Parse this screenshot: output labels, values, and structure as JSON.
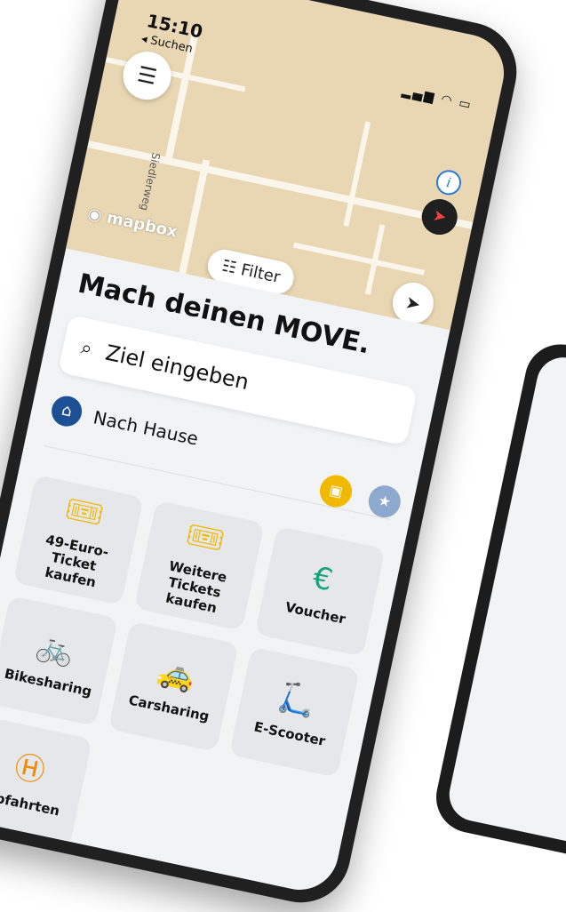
{
  "status": {
    "time": "15:10",
    "back_label": "◂ Suchen",
    "signal": "▂▄▆ ◠ ▭"
  },
  "map": {
    "attribution": "mapbox",
    "street_label": "Siedlerweg",
    "filter_label": "Filter"
  },
  "sheet": {
    "headline": "Mach deinen MOVE.",
    "search_placeholder": "Ziel eingeben",
    "home_label": "Nach Hause"
  },
  "tiles": [
    {
      "label": "49-Euro-Ticket kaufen",
      "icon": "ticket-icon",
      "color": "#f1b800"
    },
    {
      "label": "Weitere Tickets kaufen",
      "icon": "ticket-icon",
      "color": "#f1b800"
    },
    {
      "label": "Voucher",
      "icon": "euro-coin-icon",
      "color": "#13a37c"
    },
    {
      "label": "Bikesharing",
      "icon": "bike-icon",
      "color": "#1c4f94"
    },
    {
      "label": "Carsharing",
      "icon": "car-icon",
      "color": "#e0206a"
    },
    {
      "label": "E-Scooter",
      "icon": "scooter-icon",
      "color": "#7d3bb4"
    },
    {
      "label": "Abfahrten",
      "icon": "stop-h-icon",
      "color": "#f08a00"
    }
  ],
  "colors": {
    "map_bg": "#e9d7b3",
    "home_icon": "#1c4f94",
    "sheet_bg": "#f2f3f5"
  }
}
